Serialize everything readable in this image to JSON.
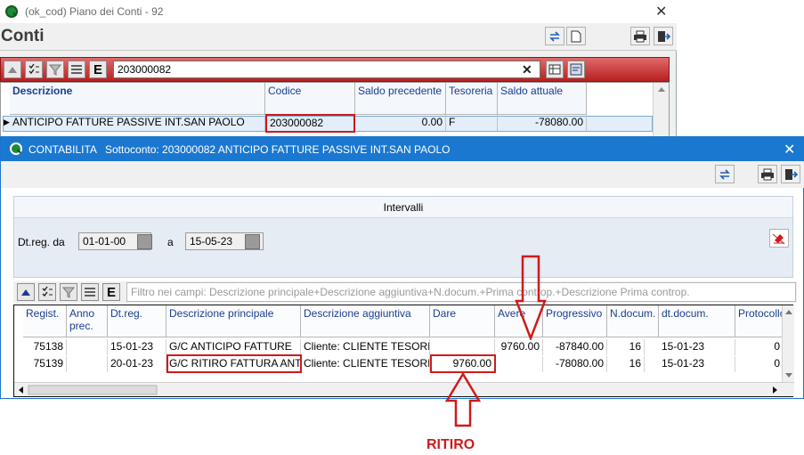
{
  "back_window": {
    "title": "(ok_cod) Piano dei Conti - 92",
    "heading": "Conti",
    "search_value": "203000082",
    "columns": [
      "Descrizione",
      "Codice",
      "Saldo precedente",
      "Tesoreria",
      "Saldo attuale"
    ],
    "row": {
      "descrizione": "ANTICIPO FATTURE PASSIVE INT.SAN PAOLO",
      "codice": "203000082",
      "saldo_precedente": "0.00",
      "tesoreria": "F",
      "saldo_attuale": "-78080.00"
    }
  },
  "front_window": {
    "app_name": "CONTABILITA",
    "subtitle": "Sottoconto: 203000082 ANTICIPO FATTURE PASSIVE INT.SAN PAOLO",
    "intervals_label": "Intervalli",
    "date_from_label": "Dt.reg. da",
    "date_from": "01-01-00",
    "date_to_label": "a",
    "date_to": "15-05-23",
    "filter_placeholder": "Filtro nei campi: Descrizione principale+Descrizione aggiuntiva+N.docum.+Prima controp.+Descrizione Prima controp.",
    "columns": [
      "Regist.",
      "Anno prec.",
      "Dt.reg.",
      "Descrizione principale",
      "Descrizione aggiuntiva",
      "Dare",
      "Avere",
      "Progressivo",
      "N.docum.",
      "dt.docum.",
      "Protocollo"
    ],
    "rows": [
      {
        "regist": "75138",
        "anno_prec": "",
        "dt_reg": "15-01-23",
        "descr_principale": "G/C ANTICIPO FATTURE",
        "descr_aggiuntiva": "Cliente: CLIENTE TESORI",
        "dare": "",
        "avere": "9760.00",
        "progressivo": "-87840.00",
        "n_docum": "16",
        "dt_docum": "15-01-23",
        "protocollo": "0"
      },
      {
        "regist": "75139",
        "anno_prec": "",
        "dt_reg": "20-01-23",
        "descr_principale": "G/C RITIRO FATTURA ANT",
        "descr_aggiuntiva": "Cliente: CLIENTE TESORI",
        "dare": "9760.00",
        "avere": "",
        "progressivo": "-78080.00",
        "n_docum": "16",
        "dt_docum": "15-01-23",
        "protocollo": "0"
      }
    ]
  },
  "annotation": {
    "label": "RITIRO",
    "color": "#d01a1a"
  },
  "colors": {
    "title_blue": "#1b78d0",
    "header_red": "#b82020",
    "column_text": "#1a3d8f"
  }
}
